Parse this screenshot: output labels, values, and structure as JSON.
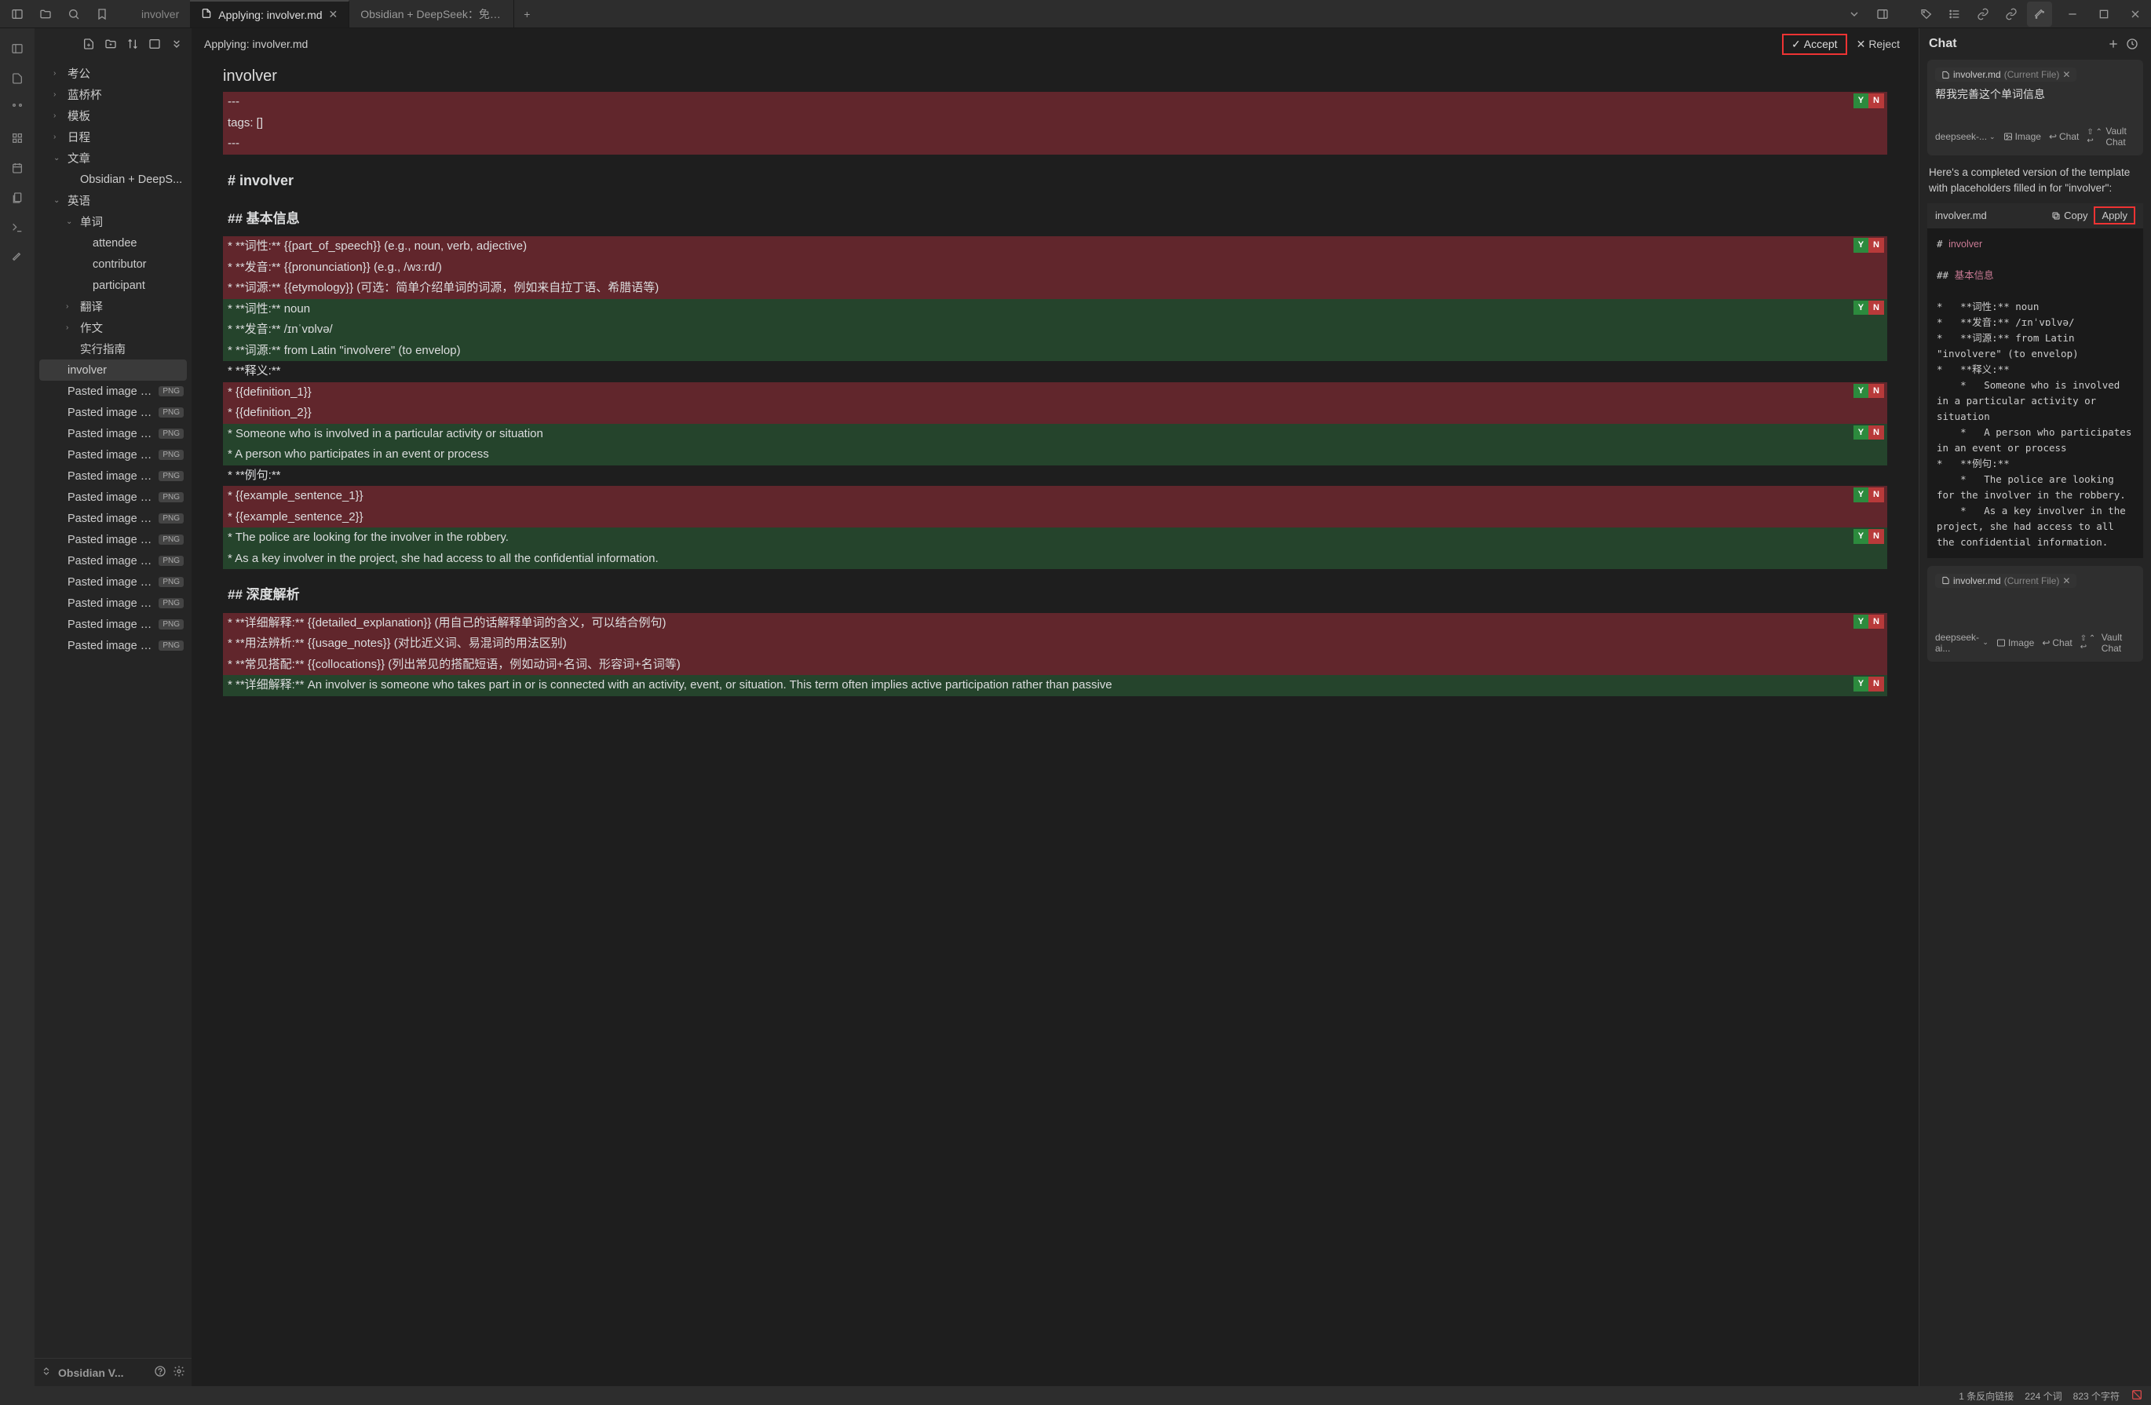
{
  "titlebar": {
    "tab_passive_left": "involver",
    "tab_active": "Applying: involver.md",
    "tab_right": "Obsidian + DeepSeek：免费 A..."
  },
  "sidebar": {
    "folders": [
      {
        "label": "考公",
        "depth": 1,
        "chev": "›"
      },
      {
        "label": "蓝桥杯",
        "depth": 1,
        "chev": "›"
      },
      {
        "label": "模板",
        "depth": 1,
        "chev": "›"
      },
      {
        "label": "日程",
        "depth": 1,
        "chev": "›"
      },
      {
        "label": "文章",
        "depth": 1,
        "chev": "⌄",
        "children": [
          {
            "label": "Obsidian + DeepS...",
            "depth": 2
          }
        ]
      },
      {
        "label": "英语",
        "depth": 1,
        "chev": "⌄",
        "children": [
          {
            "label": "单词",
            "depth": 2,
            "chev": "⌄",
            "children": [
              {
                "label": "attendee",
                "depth": 3
              },
              {
                "label": "contributor",
                "depth": 3
              },
              {
                "label": "participant",
                "depth": 3
              }
            ]
          },
          {
            "label": "翻译",
            "depth": 2,
            "chev": "›"
          },
          {
            "label": "作文",
            "depth": 2,
            "chev": "›"
          },
          {
            "label": "实行指南",
            "depth": 2
          }
        ]
      }
    ],
    "selected_file": "involver",
    "pasted_images": [
      "Pasted image 2...",
      "Pasted image 2...",
      "Pasted image 2...",
      "Pasted image 2...",
      "Pasted image 2...",
      "Pasted image 2...",
      "Pasted image 2...",
      "Pasted image 2...",
      "Pasted image 2...",
      "Pasted image 2...",
      "Pasted image 2...",
      "Pasted image 2...",
      "Pasted image 2..."
    ],
    "badge": "PNG",
    "vault_name": "Obsidian V..."
  },
  "editor": {
    "header": "Applying: involver.md",
    "accept": "Accept",
    "reject": "Reject",
    "title": "involver",
    "blocks": {
      "del1": [
        "---",
        "tags: []",
        "---"
      ],
      "h1": "# involver",
      "h2_basic": "## 基本信息",
      "del2": [
        "*   **词性:** {{part_of_speech}} (e.g., noun, verb, adjective)",
        "*   **发音:** {{pronunciation}} (e.g., /wɜːrd/)",
        "*   **词源:** {{etymology}} (可选：简单介绍单词的词源，例如来自拉丁语、希腊语等)"
      ],
      "add1": [
        "*   **词性:** noun",
        "*   **发音:** /ɪnˈvɒlvə/",
        "*   **词源:** from Latin \"involvere\" (to envelop)"
      ],
      "plain_shiyi": "*   **释义:**",
      "del3": [
        "    *   {{definition_1}}",
        "    *   {{definition_2}}"
      ],
      "add2": [
        "    *   Someone who is involved in a particular activity or situation",
        "    *   A person who participates in an event or process"
      ],
      "plain_liju": "*   **例句:**",
      "del4": [
        "    *   {{example_sentence_1}}",
        "    *   {{example_sentence_2}}"
      ],
      "add3": [
        "    *   The police are looking for the involver in the robbery.",
        "    *   As a key involver in the project, she had access to all the confidential information."
      ],
      "h2_deep": "## 深度解析",
      "del5": [
        "*   **详细解释:** {{detailed_explanation}} (用自己的话解释单词的含义，可以结合例句)",
        "*   **用法辨析:** {{usage_notes}} (对比近义词、易混词的用法区别)",
        "*   **常见搭配:** {{collocations}} (列出常见的搭配短语，例如动词+名词、形容词+名词等)"
      ],
      "add4": [
        "*   **详细解释:** An involver is someone who takes part in or is connected with an activity, event, or situation. This term often implies active participation rather than passive"
      ]
    }
  },
  "chat": {
    "title": "Chat",
    "chip_file": "involver.md",
    "chip_tag": "(Current File)",
    "user_message": "帮我完善这个单词信息",
    "footer": {
      "model": "deepseek-...",
      "image": "Image",
      "chat": "Chat",
      "vault": "Vault Chat",
      "model2": "deepseek-ai..."
    },
    "reply_intro": "Here's a completed version of the template with placeholders filled in for \"involver\":",
    "code_filename": "involver.md",
    "copy": "Copy",
    "apply": "Apply",
    "code": "# involver\n\n## 基本信息\n\n*   **词性:** noun\n*   **发音:** /ɪnˈvɒlvə/\n*   **词源:** from Latin \"involvere\" (to envelop)\n*   **释义:**\n    *   Someone who is involved in a particular activity or situation\n    *   A person who participates in an event or process\n*   **例句:**\n    *   The police are looking for the involver in the robbery.\n    *   As a key involver in the project, she had access to all the confidential information."
  },
  "statusbar": {
    "backlinks": "1 条反向链接",
    "words": "224 个词",
    "chars": "823 个字符"
  }
}
